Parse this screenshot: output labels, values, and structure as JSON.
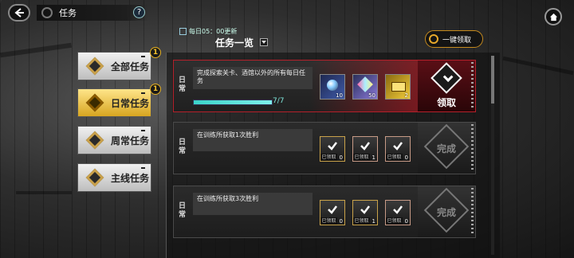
{
  "header": {
    "title": "任务",
    "help_label": "?",
    "update_info": "每日05：00更新",
    "list_title": "任务一览",
    "claim_all_label": "一键领取"
  },
  "sidebar": {
    "items": [
      {
        "label": "全部任务",
        "badge": "1",
        "active": false
      },
      {
        "label": "日常任务",
        "badge": "1",
        "active": true
      },
      {
        "label": "周常任务",
        "badge": "",
        "active": false
      },
      {
        "label": "主线任务",
        "badge": "",
        "active": false
      }
    ]
  },
  "tasks": [
    {
      "category": "日常",
      "description": "完成探索关卡、酒馆以外的所有每日任务",
      "progress_text": "7/7",
      "progress": 1.0,
      "status": "claimable",
      "action_label": "领取",
      "rewards": [
        {
          "type": "crystal",
          "count": "10"
        },
        {
          "type": "prism",
          "count": "50"
        },
        {
          "type": "ticket",
          "count": "2"
        }
      ]
    },
    {
      "category": "日常",
      "description": "在训练所获取1次胜利",
      "status": "done",
      "action_label": "完成",
      "rewards": [
        {
          "type": "claimed",
          "tag": "已领取",
          "count": "0"
        },
        {
          "type": "claimed",
          "tag": "已领取",
          "count": "1"
        },
        {
          "type": "claimed",
          "tag": "已领取",
          "count": "0"
        }
      ]
    },
    {
      "category": "日常",
      "description": "在训练所获取3次胜利",
      "status": "done",
      "action_label": "完成",
      "rewards": [
        {
          "type": "claimed",
          "tag": "已领取",
          "count": "0"
        },
        {
          "type": "claimed",
          "tag": "已领取",
          "count": "1"
        },
        {
          "type": "claimed",
          "tag": "已领取",
          "count": "0"
        }
      ]
    }
  ],
  "colors": {
    "accent_gold": "#e6b020",
    "claim_red": "#b4202a",
    "progress_teal": "#3bd4c9"
  },
  "icons": {
    "back": "back-arrow-icon",
    "home": "home-icon",
    "help": "help-icon"
  }
}
